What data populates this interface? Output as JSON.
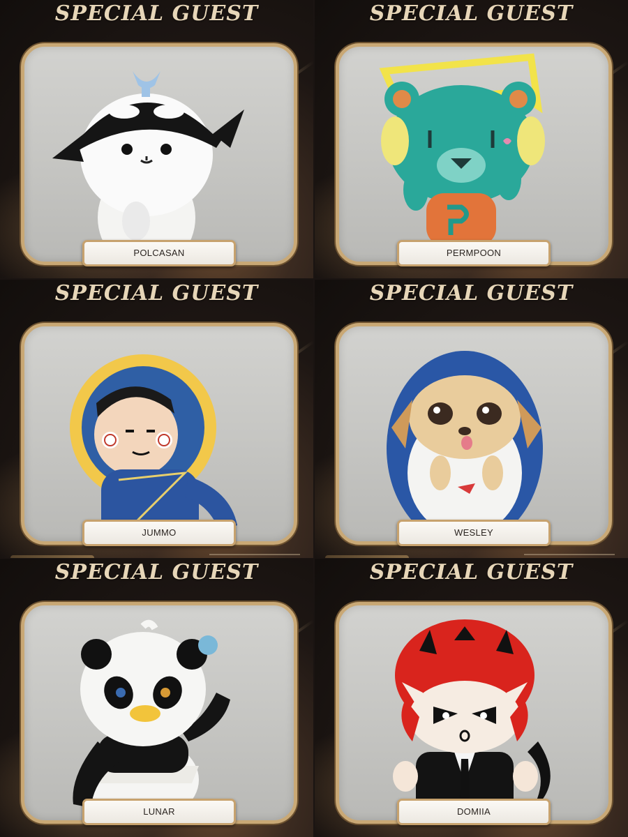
{
  "panels": [
    {
      "title": "SPECIAL GUEST",
      "name": "POLCASAN"
    },
    {
      "title": "SPECIAL GUEST",
      "name": "PERMPOON"
    },
    {
      "title": "SPECIAL GUEST",
      "name": "JUMMO"
    },
    {
      "title": "SPECIAL GUEST",
      "name": "WESLEY"
    },
    {
      "title": "SPECIAL GUEST",
      "name": "LUNAR"
    },
    {
      "title": "SPECIAL GUEST",
      "name": "DOMIIA"
    }
  ],
  "colors": {
    "gold": "#c9a875",
    "frame_bg": "#c8c8c5",
    "title_text": "#e7d6b8",
    "background": "#1a1412"
  }
}
